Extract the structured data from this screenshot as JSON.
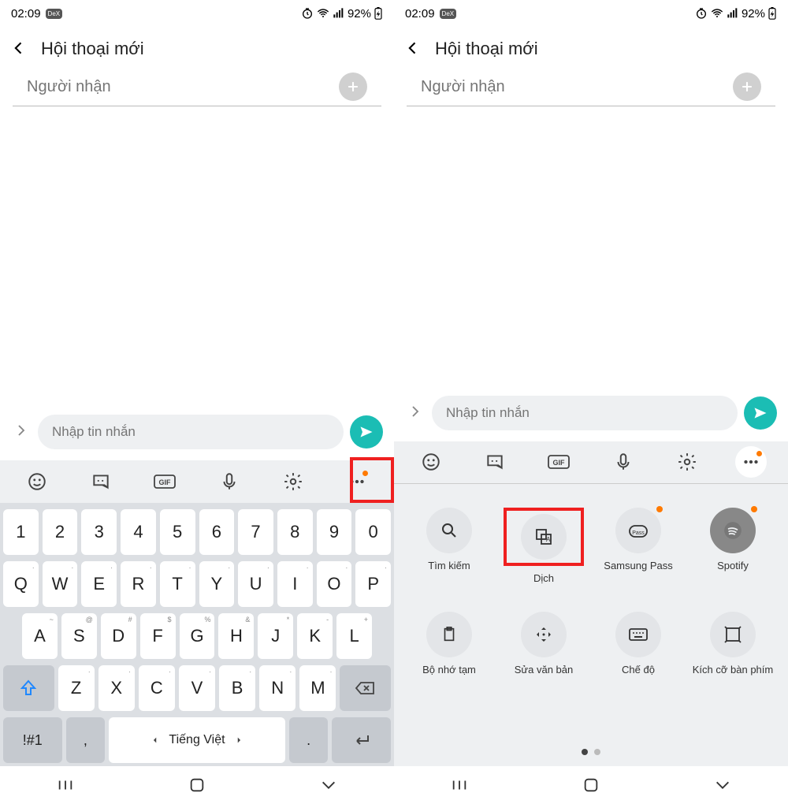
{
  "status": {
    "time": "02:09",
    "dex": "DeX",
    "battery": "92%"
  },
  "header": {
    "title": "Hội thoại mới"
  },
  "recipient": {
    "placeholder": "Người nhận"
  },
  "compose": {
    "placeholder": "Nhập tin nhắn"
  },
  "keyboard": {
    "row1": [
      "1",
      "2",
      "3",
      "4",
      "5",
      "6",
      "7",
      "8",
      "9",
      "0"
    ],
    "row2": [
      "Q",
      "W",
      "E",
      "R",
      "T",
      "Y",
      "U",
      "I",
      "O",
      "P"
    ],
    "row2_sub": [
      "·",
      "·",
      "·",
      "·",
      "·",
      "·",
      "·",
      "·",
      "·",
      "·"
    ],
    "row3": [
      "A",
      "S",
      "D",
      "F",
      "G",
      "H",
      "J",
      "K",
      "L"
    ],
    "row3_sub": [
      "~",
      "@",
      "#",
      "$",
      "%",
      "&",
      "*",
      "-",
      "+"
    ],
    "row4": [
      "Z",
      "X",
      "C",
      "V",
      "B",
      "N",
      "M"
    ],
    "row4_sub": [
      "·",
      "·",
      "·",
      "·",
      "·",
      "·",
      "·"
    ],
    "sym": "!#1",
    "comma": ",",
    "space": "Tiếng Việt",
    "period": "."
  },
  "panel": {
    "items": [
      {
        "label": "Tìm kiếm",
        "icon": "search"
      },
      {
        "label": "Dịch",
        "icon": "translate",
        "highlight": true
      },
      {
        "label": "Samsung Pass",
        "icon": "pass",
        "dot": true
      },
      {
        "label": "Spotify",
        "icon": "spotify",
        "dot": true
      },
      {
        "label": "Bộ nhớ tạm",
        "icon": "clipboard"
      },
      {
        "label": "Sửa văn bản",
        "icon": "move"
      },
      {
        "label": "Chế độ",
        "icon": "mode"
      },
      {
        "label": "Kích cỡ bàn phím",
        "icon": "resize"
      }
    ]
  }
}
